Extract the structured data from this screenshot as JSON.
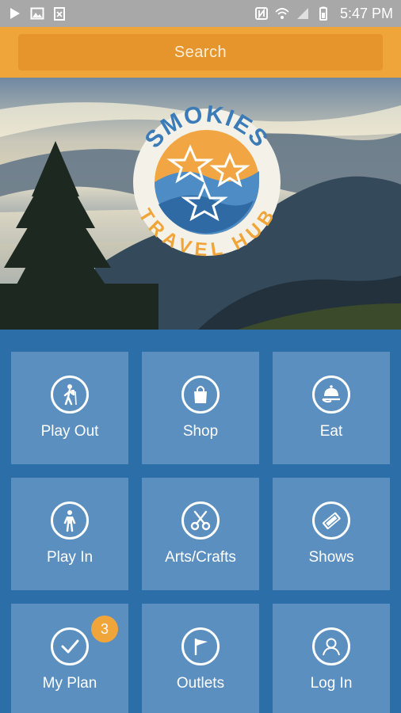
{
  "status_bar": {
    "time": "5:47 PM",
    "left_icons": [
      "play-store-icon",
      "image-icon",
      "clipboard-icon"
    ],
    "right_icons": [
      "nfc-icon",
      "wifi-icon",
      "signal-icon",
      "battery-icon"
    ]
  },
  "search": {
    "label": "Search"
  },
  "hero": {
    "logo_top_text": "SMOKIES",
    "logo_bottom_text": "TRAVEL HUB"
  },
  "tiles": [
    {
      "label": "Play Out",
      "icon": "hiker-icon"
    },
    {
      "label": "Shop",
      "icon": "shopping-bag-icon"
    },
    {
      "label": "Eat",
      "icon": "cloche-icon"
    },
    {
      "label": "Play In",
      "icon": "walking-person-icon"
    },
    {
      "label": "Arts/Crafts",
      "icon": "scissors-icon"
    },
    {
      "label": "Shows",
      "icon": "ticket-icon"
    },
    {
      "label": "My Plan",
      "icon": "checkmark-icon",
      "badge": "3"
    },
    {
      "label": "Outlets",
      "icon": "flag-icon"
    },
    {
      "label": "Log In",
      "icon": "user-icon"
    }
  ],
  "colors": {
    "status_bar": "#a8a8a8",
    "search_bar": "#f0a53a",
    "search_field": "#e6952c",
    "grid_background": "#2b6ea8",
    "tile": "#5b8fbf",
    "badge": "#f0a53a"
  }
}
